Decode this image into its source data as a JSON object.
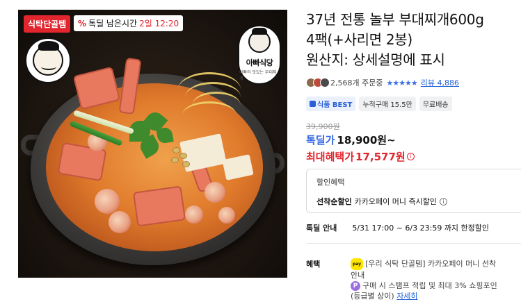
{
  "image_overlay": {
    "tag": "식탁단골템",
    "timer_prefix": "%",
    "timer_text": "톡딜 남은시간",
    "timer_remaining": "2일 12:20",
    "brand_name": "아빠식당",
    "brand_sub": "아빠의 맛있는 부대찌개"
  },
  "product": {
    "title_line1": "37년 전통 놀부 부대찌개600g",
    "title_line2": "4팩(+사리면 2봉)",
    "title_line3": "원산지: 상세설명에 표시"
  },
  "rating": {
    "orders": "2,568개 주문중",
    "stars": "★★★★★",
    "review_label": "리뷰 4,886"
  },
  "badges": {
    "best": "식품 BEST",
    "cumulative": "누적구매 15.5만",
    "shipping": "무료배송"
  },
  "price": {
    "original": "39,900원",
    "deal_label": "톡딜가",
    "deal_price": "18,900원~",
    "max_label": "최대혜택가",
    "max_price": "17,577원"
  },
  "discount": {
    "title": "할인혜택",
    "line_label": "선착순할인",
    "line_text": "카카오페이 머니 즉시할인"
  },
  "deal_period": {
    "label": "톡딜 안내",
    "text": "5/31 17:00 ~ 6/3 23:59 까지 한정할인"
  },
  "benefits": {
    "label": "혜택",
    "pay_icon": "pay",
    "line1": "[우리 식탁 단골템] 카카오페이 머니 선착",
    "line1_cont": "안내",
    "line2": "구매 시 스탬프 적립 및 최대 3% 쇼핑포인",
    "line2_cont": "(등급별 상이)",
    "more": "자세히"
  },
  "colors": {
    "accent_red": "#e2262e",
    "accent_blue": "#3267e3",
    "link_blue": "#1c5fd8"
  }
}
